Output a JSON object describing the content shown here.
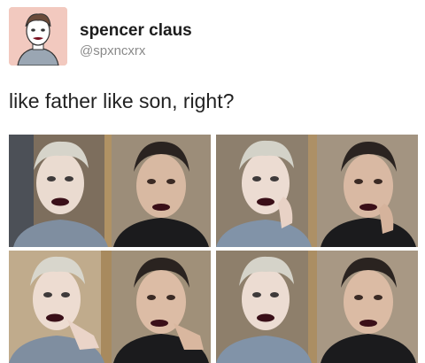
{
  "tweet": {
    "display_name": "spencer claus",
    "handle": "@spxncxrx",
    "text": "like father like son, right?"
  },
  "avatar_icon": "cartoon-avatar-icon",
  "colors": {
    "avatar_bg": "#f2c9bf",
    "name": "#1c1c1c",
    "handle": "#8a8a8a",
    "lipstick": "#3a0f18"
  },
  "photos": [
    {
      "label": "photo-1"
    },
    {
      "label": "photo-2"
    },
    {
      "label": "photo-3"
    },
    {
      "label": "photo-4"
    }
  ]
}
